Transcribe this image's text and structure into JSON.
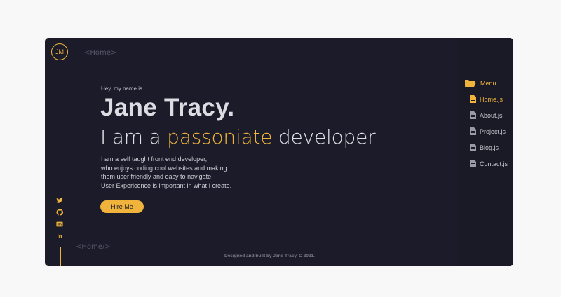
{
  "brand": {
    "initials": "JM"
  },
  "tags": {
    "open": "<Home>",
    "close": "<Home/>"
  },
  "hero": {
    "greeting": "Hey, my name is",
    "name": "Jane Tracy.",
    "headline_pre": "I am a ",
    "headline_accent": "passoniate",
    "headline_post": " developer",
    "bio_lines": [
      "I am a self taught front end developer,",
      "who enjoys coding cool websites and making",
      "them user friendly and easy to navigate.",
      "User Expericence is important in what I create."
    ],
    "cta": "Hire Me"
  },
  "socials": [
    {
      "icon": "twitter-icon"
    },
    {
      "icon": "github-icon"
    },
    {
      "icon": "devto-icon",
      "label": "DEV"
    },
    {
      "icon": "linkedin-icon",
      "label": "in"
    }
  ],
  "footer": "Designed and built by Jane Tracy, C 2021.",
  "menu": {
    "title": "Menu",
    "items": [
      {
        "label": "Home.js",
        "active": true
      },
      {
        "label": "About.js"
      },
      {
        "label": "Project.js"
      },
      {
        "label": "Blog.js"
      },
      {
        "label": "Contact.js"
      }
    ]
  },
  "colors": {
    "accent": "#f0b43c",
    "background": "#1b1b29",
    "page": "#f8f8f8"
  }
}
